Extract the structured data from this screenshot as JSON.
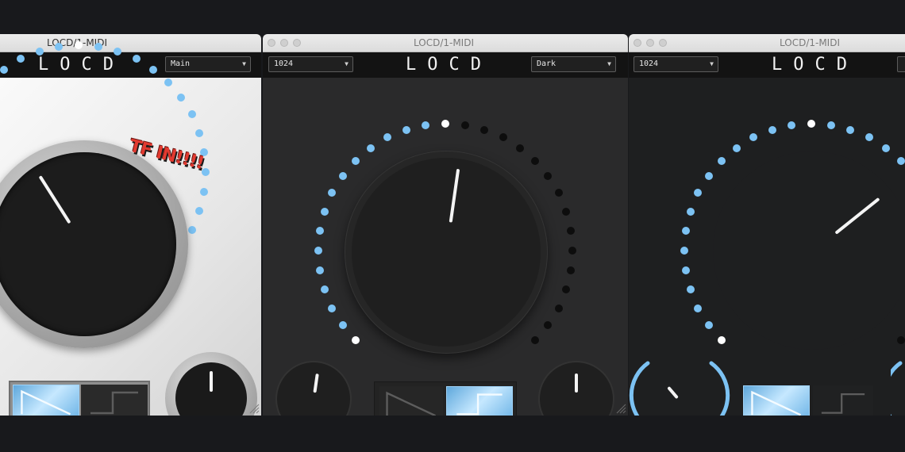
{
  "colors": {
    "accent": "#7cc2f3",
    "accent_bright": "#b9e2ff",
    "dot_inactive": "#0d0d0d",
    "dot_marker": "#ffffff",
    "desktop": "#18191c"
  },
  "windows": [
    {
      "id": "w1",
      "title": "LOCD/1-MIDI",
      "theme_label": "Main",
      "logo": "LOCD",
      "sticker": "TF IN!!!!",
      "ring": {
        "value": 1.0,
        "count": 31,
        "marker": 0.5
      },
      "main_knob": {
        "value": 0.38
      },
      "small_knob": {
        "value": 0.5
      },
      "waveform": {
        "selected": "saw",
        "options": [
          "saw",
          "square"
        ]
      }
    },
    {
      "id": "w2",
      "title": "LOCD/1-MIDI",
      "preset_label": "1024",
      "theme_label": "Dark",
      "logo": "LOCD",
      "ring": {
        "value": 0.5,
        "count": 31,
        "marker": 0.5
      },
      "main_knob": {
        "value": 0.53
      },
      "small_knob_left": {
        "value": 0.53
      },
      "small_knob_right": {
        "value": 0.5
      },
      "waveform": {
        "selected": "square",
        "options": [
          "saw",
          "square"
        ]
      }
    },
    {
      "id": "w3",
      "title": "LOCD/1-MIDI",
      "preset_label": "1024",
      "logo": "LOCD",
      "ring": {
        "value": 0.72,
        "count": 31,
        "marker": 0.5
      },
      "main_knob": {
        "value": 0.69
      },
      "small_knob_left": {
        "value": 0.35
      },
      "waveform": {
        "selected": "saw",
        "options": [
          "saw",
          "square"
        ]
      }
    }
  ],
  "icons": {
    "dropdown_caret": "chevron-down-icon",
    "resize": "resize-grip-icon",
    "saw": "saw-wave-icon",
    "square": "square-wave-icon"
  }
}
